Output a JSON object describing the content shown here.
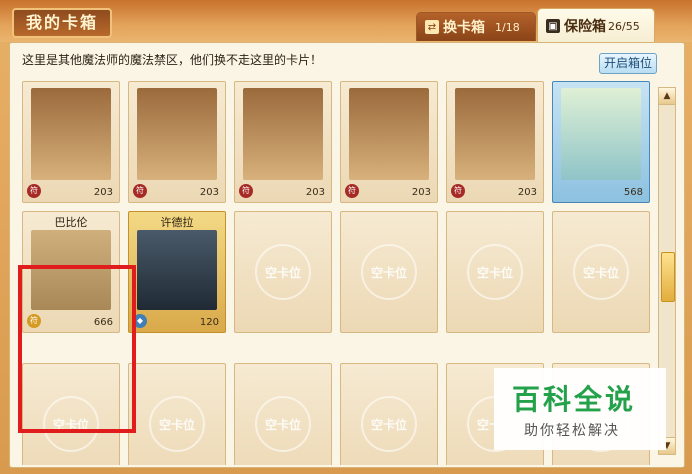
{
  "window": {
    "title": "我的卡箱"
  },
  "tabs": {
    "exchange": {
      "label": "换卡箱",
      "count": "1/18"
    },
    "safe": {
      "label": "保险箱",
      "count": "26/55"
    }
  },
  "panel": {
    "notice": "这里是其他魔法师的魔法禁区，他们换不走这里的卡片！",
    "open_slot_label": "开启箱位"
  },
  "cards": {
    "row1": [
      "203",
      "203",
      "203",
      "203",
      "203",
      "568"
    ],
    "babylon": {
      "name": "巴比伦",
      "value": "666"
    },
    "xudela": {
      "name": "许德拉",
      "value": "120"
    },
    "empty_label": "空卡位"
  },
  "watermark": {
    "title": "百科全说",
    "subtitle": "助你轻松解决"
  }
}
